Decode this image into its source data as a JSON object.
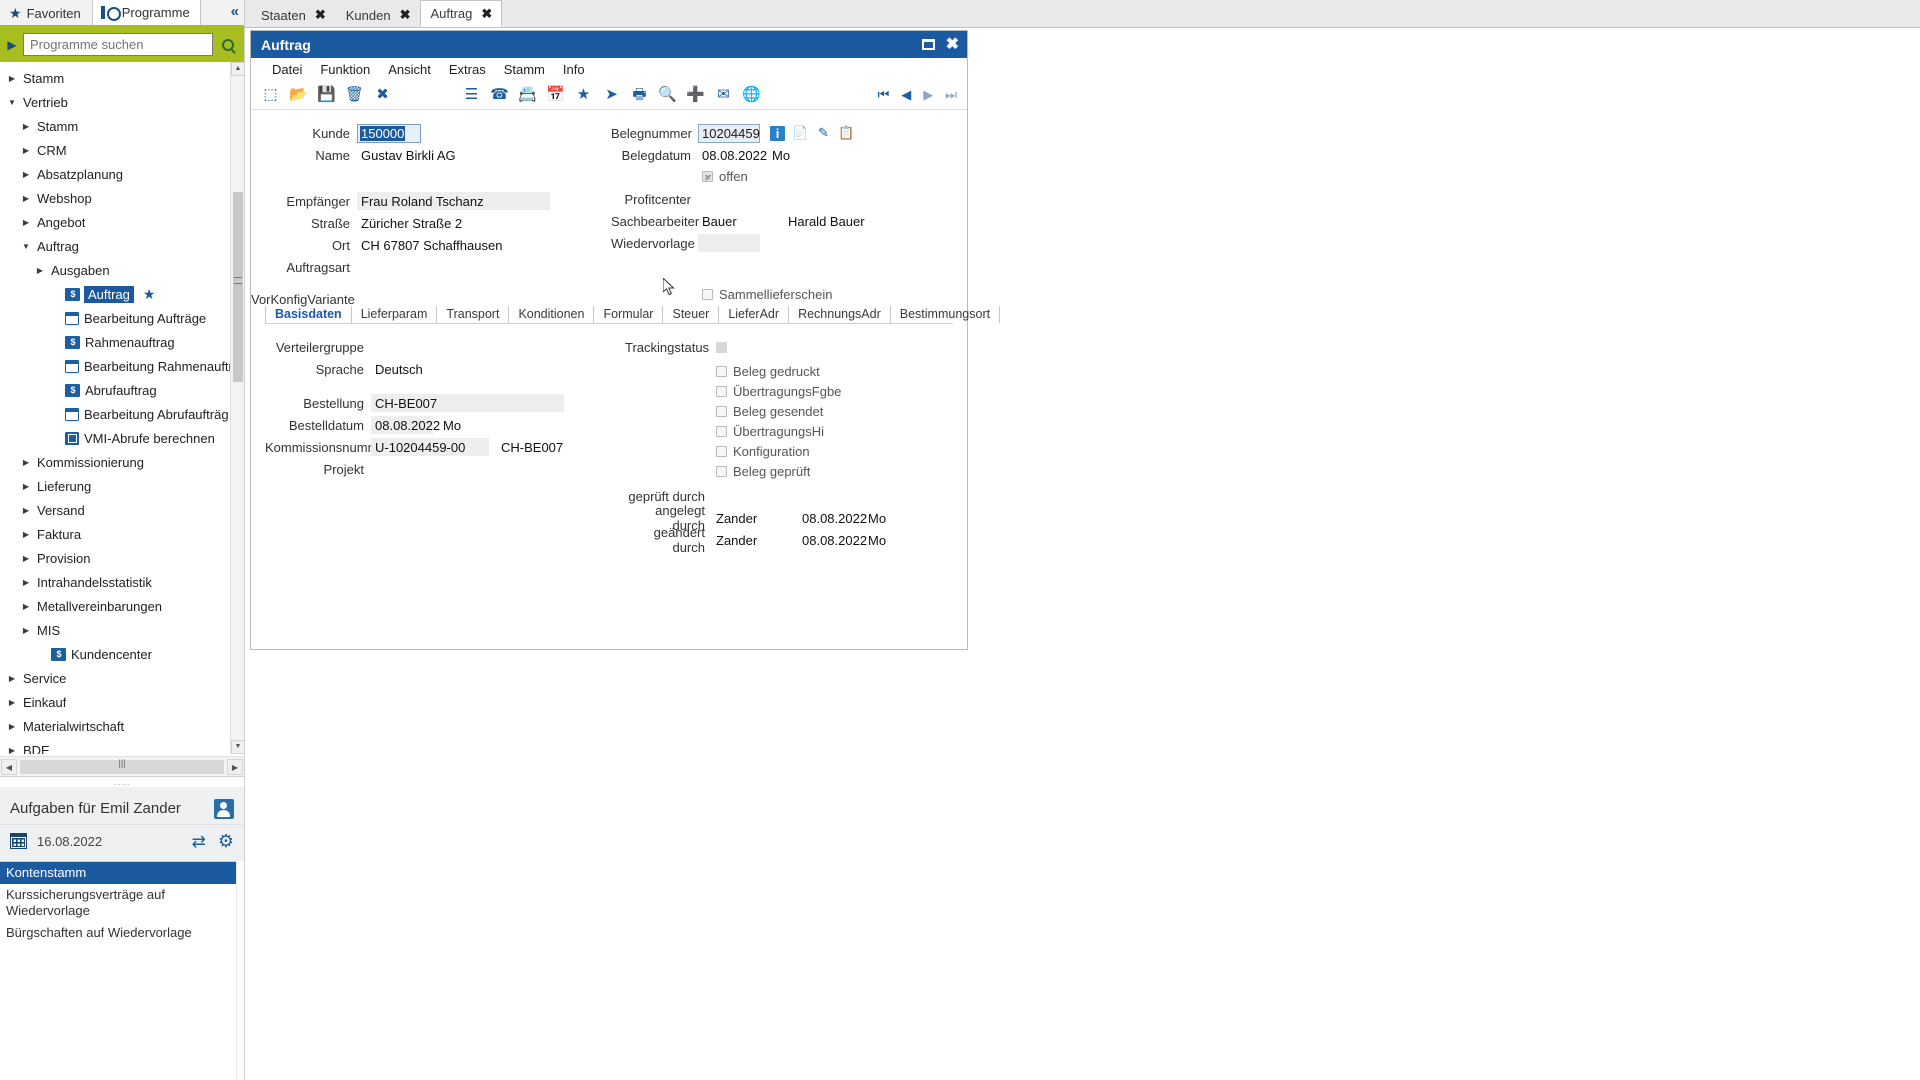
{
  "left_panel": {
    "tabs": [
      {
        "label": "Favoriten",
        "icon": "star-icon",
        "active": false
      },
      {
        "label": "Programme",
        "icon": "programs-icon",
        "active": true
      }
    ],
    "collapse_icon": "double-chevron-left-icon",
    "search": {
      "placeholder": "Programme suchen",
      "value": "",
      "icon": "search-icon",
      "expand_icon": "play-arrow-icon"
    },
    "tree": [
      {
        "label": "Stamm",
        "level": 0,
        "state": "collapsed",
        "icon": null
      },
      {
        "label": "Vertrieb",
        "level": 0,
        "state": "expanded",
        "icon": null
      },
      {
        "label": "Stamm",
        "level": 1,
        "state": "collapsed",
        "icon": null
      },
      {
        "label": "CRM",
        "level": 1,
        "state": "collapsed",
        "icon": null
      },
      {
        "label": "Absatzplanung",
        "level": 1,
        "state": "collapsed",
        "icon": null
      },
      {
        "label": "Webshop",
        "level": 1,
        "state": "collapsed",
        "icon": null
      },
      {
        "label": "Angebot",
        "level": 1,
        "state": "collapsed",
        "icon": null
      },
      {
        "label": "Auftrag",
        "level": 1,
        "state": "expanded",
        "icon": null
      },
      {
        "label": "Ausgaben",
        "level": 2,
        "state": "collapsed",
        "icon": null
      },
      {
        "label": "Auftrag",
        "level": 3,
        "state": "leaf",
        "icon": "program-sh-icon",
        "selected": true,
        "favorite": true
      },
      {
        "label": "Bearbeitung Aufträge",
        "level": 3,
        "state": "leaf",
        "icon": "window-icon"
      },
      {
        "label": "Rahmenauftrag",
        "level": 3,
        "state": "leaf",
        "icon": "program-sh-icon"
      },
      {
        "label": "Bearbeitung Rahmenauftr",
        "level": 3,
        "state": "leaf",
        "icon": "window-icon"
      },
      {
        "label": "Abrufauftrag",
        "level": 3,
        "state": "leaf",
        "icon": "program-sh-icon"
      },
      {
        "label": "Bearbeitung Abrufaufträg",
        "level": 3,
        "state": "leaf",
        "icon": "window-icon"
      },
      {
        "label": "VMI-Abrufe berechnen",
        "level": 3,
        "state": "leaf",
        "icon": "vmi-icon"
      },
      {
        "label": "Kommissionierung",
        "level": 1,
        "state": "collapsed",
        "icon": null
      },
      {
        "label": "Lieferung",
        "level": 1,
        "state": "collapsed",
        "icon": null
      },
      {
        "label": "Versand",
        "level": 1,
        "state": "collapsed",
        "icon": null
      },
      {
        "label": "Faktura",
        "level": 1,
        "state": "collapsed",
        "icon": null
      },
      {
        "label": "Provision",
        "level": 1,
        "state": "collapsed",
        "icon": null
      },
      {
        "label": "Intrahandelsstatistik",
        "level": 1,
        "state": "collapsed",
        "icon": null
      },
      {
        "label": "Metallvereinbarungen",
        "level": 1,
        "state": "collapsed",
        "icon": null
      },
      {
        "label": "MIS",
        "level": 1,
        "state": "collapsed",
        "icon": null
      },
      {
        "label": "Kundencenter",
        "level": 2,
        "state": "leaf",
        "icon": "program-sh-icon"
      },
      {
        "label": "Service",
        "level": 0,
        "state": "collapsed",
        "icon": null
      },
      {
        "label": "Einkauf",
        "level": 0,
        "state": "collapsed",
        "icon": null
      },
      {
        "label": "Materialwirtschaft",
        "level": 0,
        "state": "collapsed",
        "icon": null
      },
      {
        "label": "BDE",
        "level": 0,
        "state": "collapsed",
        "icon": null
      }
    ],
    "tasks": {
      "title": "Aufgaben für Emil Zander",
      "person_icon": "person-icon",
      "date": "16.08.2022",
      "calendar_icon": "calendar-icon",
      "refresh_icon": "refresh-icon",
      "settings_icon": "gear-icon",
      "items": [
        {
          "label": "Kontenstamm",
          "selected": true
        },
        {
          "label": "Kurssicherungsverträge auf Wiedervorlage",
          "selected": false
        },
        {
          "label": "Bürgschaften auf Wiedervorlage",
          "selected": false
        }
      ]
    }
  },
  "top_tabs": [
    {
      "label": "Staaten",
      "active": false,
      "close_icon": "close-icon"
    },
    {
      "label": "Kunden",
      "active": false,
      "close_icon": "close-icon"
    },
    {
      "label": "Auftrag",
      "active": true,
      "close_icon": "close-icon"
    }
  ],
  "window": {
    "title": "Auftrag",
    "maximize_icon": "maximize-icon",
    "close_icon": "close-icon",
    "menu": [
      "Datei",
      "Funktion",
      "Ansicht",
      "Extras",
      "Stamm",
      "Info"
    ],
    "toolbar_left": [
      {
        "name": "new-document-icon",
        "glyph": "⬚"
      },
      {
        "name": "open-folder-icon",
        "glyph": "📂"
      },
      {
        "name": "save-icon",
        "glyph": "💾"
      },
      {
        "name": "delete-trash-icon",
        "glyph": "🗑"
      },
      {
        "name": "cancel-x-icon",
        "glyph": "✖"
      }
    ],
    "toolbar_right": [
      {
        "name": "list-view-icon",
        "glyph": "☰"
      },
      {
        "name": "phone-icon",
        "glyph": "☎"
      },
      {
        "name": "contact-add-icon",
        "glyph": "📇"
      },
      {
        "name": "calendar-icon",
        "glyph": "📅"
      },
      {
        "name": "favorite-star-icon",
        "glyph": "★"
      },
      {
        "name": "forward-arrow-icon",
        "glyph": "➤"
      },
      {
        "name": "print-icon",
        "glyph": "🖶"
      },
      {
        "name": "preview-icon",
        "glyph": "🔍"
      },
      {
        "name": "add-plus-icon",
        "glyph": "➕"
      },
      {
        "name": "mail-icon",
        "glyph": "✉"
      },
      {
        "name": "globe-icon",
        "glyph": "🌐"
      }
    ],
    "nav": [
      {
        "name": "first-record-icon",
        "glyph": "⏮"
      },
      {
        "name": "previous-record-icon",
        "glyph": "◀"
      },
      {
        "name": "next-record-icon",
        "glyph": "▶"
      },
      {
        "name": "last-record-icon",
        "glyph": "⏭"
      }
    ]
  },
  "header_form": {
    "left": {
      "kunde_label": "Kunde",
      "kunde_value": "150000",
      "name_label": "Name",
      "name_value": "Gustav Birkli AG",
      "empfaenger_label": "Empfänger",
      "empfaenger_value": "Frau Roland Tschanz",
      "strasse_label": "Straße",
      "strasse_value": "Züricher Straße 2",
      "ort_label": "Ort",
      "ort_value": "CH 67807 Schaffhausen",
      "auftragsart_label": "Auftragsart",
      "auftragsart_value": "",
      "vorkonfig_label": "VorKonfigVariante",
      "vorkonfig_value": ""
    },
    "right": {
      "belegnummer_label": "Belegnummer",
      "belegnummer_value": "10204459",
      "beleg_icons": [
        {
          "name": "info-icon",
          "glyph": "i"
        },
        {
          "name": "document-add-icon",
          "glyph": "📄"
        },
        {
          "name": "edit-document-icon",
          "glyph": "✎"
        },
        {
          "name": "copy-document-icon",
          "glyph": "📋"
        }
      ],
      "belegdatum_label": "Belegdatum",
      "belegdatum_value": "08.08.2022",
      "belegdatum_day": "Mo",
      "offen_label": "offen",
      "offen_checked": true,
      "profitcenter_label": "Profitcenter",
      "profitcenter_value": "",
      "sachbearbeiter_label": "Sachbearbeiter",
      "sachbearbeiter_value": "Bauer",
      "sachbearbeiter_name": "Harald Bauer",
      "wiedervorlage_label": "Wiedervorlage",
      "wiedervorlage_value": "",
      "sammellieferschein_label": "Sammellieferschein",
      "sammellieferschein_checked": false
    }
  },
  "tabs": [
    {
      "label": "Basisdaten",
      "active": true
    },
    {
      "label": "Lieferparam",
      "active": false
    },
    {
      "label": "Transport",
      "active": false
    },
    {
      "label": "Konditionen",
      "active": false
    },
    {
      "label": "Formular",
      "active": false
    },
    {
      "label": "Steuer",
      "active": false
    },
    {
      "label": "LieferAdr",
      "active": false
    },
    {
      "label": "RechnungsAdr",
      "active": false
    },
    {
      "label": "Bestimmungsort",
      "active": false
    }
  ],
  "basisdaten": {
    "left": {
      "verteilergruppe_label": "Verteilergruppe",
      "verteilergruppe_value": "",
      "sprache_label": "Sprache",
      "sprache_value": "Deutsch",
      "bestellung_label": "Bestellung",
      "bestellung_value": "CH-BE007",
      "bestelldatum_label": "Bestelldatum",
      "bestelldatum_value": "08.08.2022",
      "bestelldatum_day": "Mo",
      "kommissionsnummer_label": "Kommissionsnummer",
      "kommissionsnummer_value": "U-10204459-00",
      "kommissionsnummer_extra": "CH-BE007",
      "projekt_label": "Projekt",
      "projekt_value": ""
    },
    "right": {
      "trackingstatus_label": "Trackingstatus",
      "checkboxes": [
        {
          "label": "Beleg gedruckt",
          "checked": false
        },
        {
          "label": "ÜbertragungsFgbe",
          "checked": false
        },
        {
          "label": "Beleg gesendet",
          "checked": false
        },
        {
          "label": "ÜbertragungsHi",
          "checked": false
        },
        {
          "label": "Konfiguration",
          "checked": false
        },
        {
          "label": "Beleg geprüft",
          "checked": false
        }
      ],
      "geprueft_durch_label": "geprüft durch",
      "geprueft_durch_value": "",
      "geprueft_durch_date": "",
      "geprueft_durch_day": "",
      "angelegt_durch_label": "angelegt durch",
      "angelegt_durch_value": "Zander",
      "angelegt_durch_date": "08.08.2022",
      "angelegt_durch_day": "Mo",
      "geaendert_durch_label": "geändert durch",
      "geaendert_durch_value": "Zander",
      "geaendert_durch_date": "08.08.2022",
      "geaendert_durch_day": "Mo"
    }
  },
  "colors": {
    "accent_blue": "#1b5a9e",
    "title_blue": "#1b5a9e",
    "search_green": "#a8bd1f",
    "icon_blue": "#1b5f9e",
    "field_grey": "#eeeeee"
  }
}
